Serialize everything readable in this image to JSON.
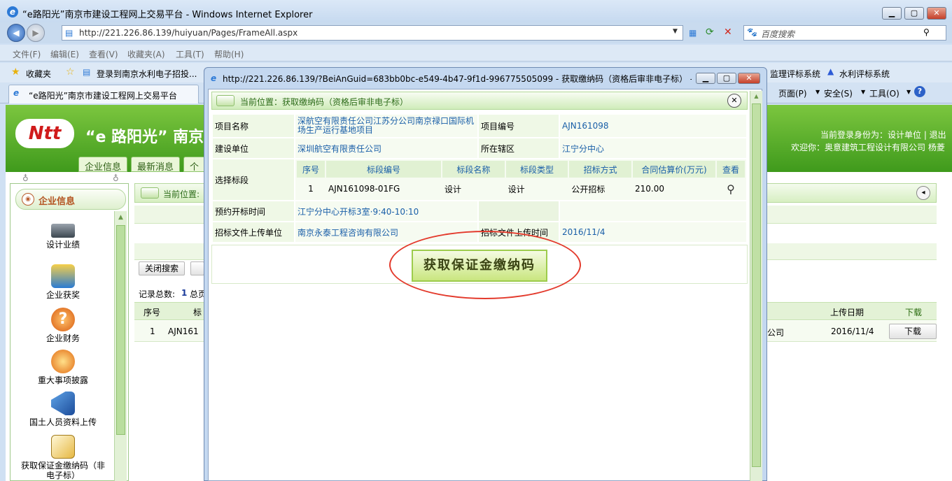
{
  "browser": {
    "title": "“e路阳光”南京市建设工程网上交易平台 - Windows Internet Explorer",
    "url": "http://221.226.86.139/huiyuan/Pages/FrameAll.aspx",
    "search_placeholder": "百度搜索",
    "menu": [
      "文件(F)",
      "编辑(E)",
      "查看(V)",
      "收藏夹(A)",
      "工具(T)",
      "帮助(H)"
    ],
    "favorites_label": "收藏夹",
    "fav_link": "登录到南京水利电子招投...",
    "fav_right_1": "监理评标系统",
    "fav_right_2": "水利评标系统",
    "tab_title": "“e路阳光”南京市建设工程网上交易平台",
    "cmd_page": "页面(P)",
    "cmd_safety": "安全(S)",
    "cmd_tools": "工具(O)"
  },
  "site": {
    "logo_text": "Ntt",
    "title": "“e 路阳光” 南京",
    "nav": [
      "企业信息",
      "最新消息",
      "个人"
    ],
    "user_role": "当前登录身份为：设计单位 | 退出",
    "welcome": "欢迎你：奥意建筑工程设计有限公司  杨菱"
  },
  "sidebar": {
    "header": "企业信息",
    "items": [
      {
        "label": "设计业绩",
        "icon": "scanner-icon"
      },
      {
        "label": "企业获奖",
        "icon": "award-icon"
      },
      {
        "label": "企业财务",
        "icon": "question-icon"
      },
      {
        "label": "重大事项披露",
        "icon": "person-icon"
      },
      {
        "label": "国土人员资料上传",
        "icon": "megaphone-icon"
      },
      {
        "label": "获取保证金缴纳码（非电子标）",
        "icon": "document-pen-icon"
      }
    ]
  },
  "main": {
    "position_label": "当前位置:",
    "close_search_btn": "关闭搜索",
    "record_total_label": "记录总数:",
    "record_total": "1",
    "record_total_suffix": "总页",
    "columns": {
      "seq": "序号",
      "bid": "标",
      "upload_date": "上传日期",
      "download": "下载"
    },
    "row": {
      "seq": "1",
      "bid": "AJN161",
      "company_tail": "公司",
      "upload_date": "2016/11/4",
      "download_btn": "下载"
    }
  },
  "popup": {
    "title": "http://221.226.86.139/?BeiAnGuid=683bb0bc-e549-4b47-9f1d-996775505099 - 获取缴纳码（资格后审非电子标） - ...",
    "location": "当前位置：获取缴纳码（资格后审非电子标）",
    "fields": {
      "project_name_label": "项目名称",
      "project_name": "深航空有限责任公司江苏分公司南京禄口国际机场生产运行基地项目",
      "project_no_label": "项目编号",
      "project_no": "AJN161098",
      "builder_label": "建设单位",
      "builder": "深圳航空有限责任公司",
      "district_label": "所在辖区",
      "district": "江宁分中心",
      "section_label": "选择标段",
      "reserve_label": "预约开标时间",
      "reserve": "江宁分中心开标3室·9:40-10:10",
      "uploader_label": "招标文件上传单位",
      "uploader": "南京永泰工程咨询有限公司",
      "upload_time_label": "招标文件上传时间",
      "upload_time": "2016/11/4"
    },
    "section_table": {
      "headers": [
        "序号",
        "标段编号",
        "标段名称",
        "标段类型",
        "招标方式",
        "合同估算价(万元)",
        "查看"
      ],
      "row": [
        "1",
        "AJN161098-01FG",
        "设计",
        "设计",
        "公开招标",
        "210.00"
      ]
    },
    "get_code_btn": "获取保证金缴纳码"
  }
}
